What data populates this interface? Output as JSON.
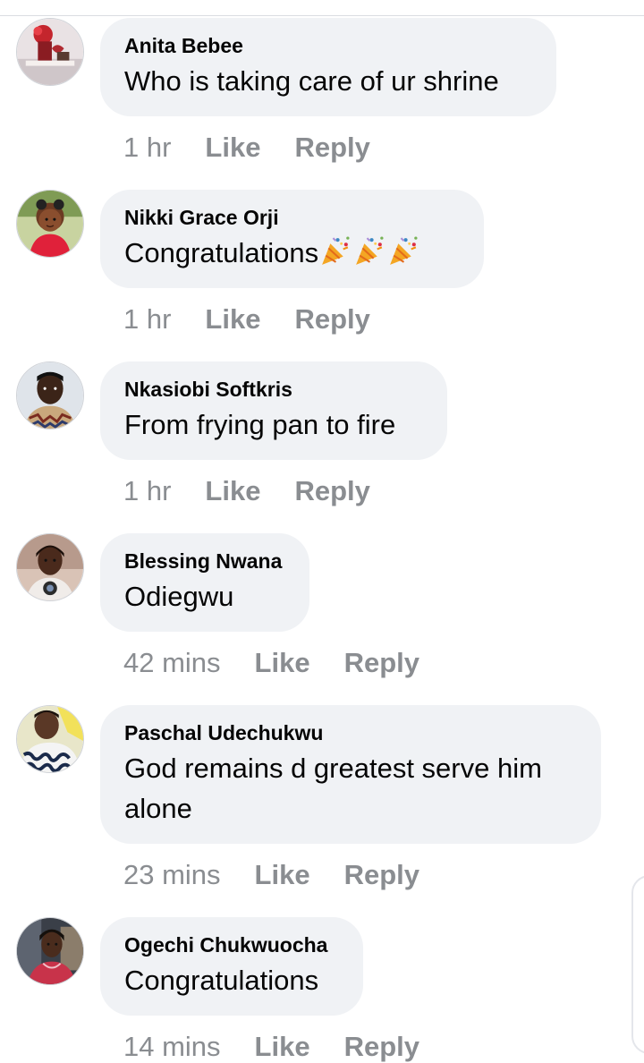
{
  "comments": [
    {
      "author": "Anita Bebee",
      "text": "Who is taking care of ur shrine",
      "time": "1 hr",
      "like_label": "Like",
      "reply_label": "Reply",
      "avatar_icon": "avatar-anita-bebee"
    },
    {
      "author": "Nikki Grace Orji",
      "text": "Congratulations",
      "emoji_icons": [
        "party-popper-icon",
        "party-popper-icon",
        "party-popper-icon"
      ],
      "time": "1 hr",
      "like_label": "Like",
      "reply_label": "Reply",
      "avatar_icon": "avatar-nikki-grace-orji"
    },
    {
      "author": "Nkasiobi Softkris",
      "text": "From frying pan to fire",
      "time": "1 hr",
      "like_label": "Like",
      "reply_label": "Reply",
      "avatar_icon": "avatar-nkasiobi-softkris"
    },
    {
      "author": "Blessing Nwana",
      "text": "Odiegwu",
      "time": "42 mins",
      "like_label": "Like",
      "reply_label": "Reply",
      "avatar_icon": "avatar-blessing-nwana"
    },
    {
      "author": "Paschal Udechukwu",
      "text": "God remains d greatest serve him alone",
      "time": "23 mins",
      "like_label": "Like",
      "reply_label": "Reply",
      "avatar_icon": "avatar-paschal-udechukwu"
    },
    {
      "author": "Ogechi Chukwuocha",
      "text": "Congratulations",
      "time": "14 mins",
      "like_label": "Like",
      "reply_label": "Reply",
      "avatar_icon": "avatar-ogechi-chukwuocha"
    }
  ],
  "colors": {
    "bubble_bg": "#f0f2f5",
    "text": "#050505",
    "meta_text": "#8a8d91"
  }
}
